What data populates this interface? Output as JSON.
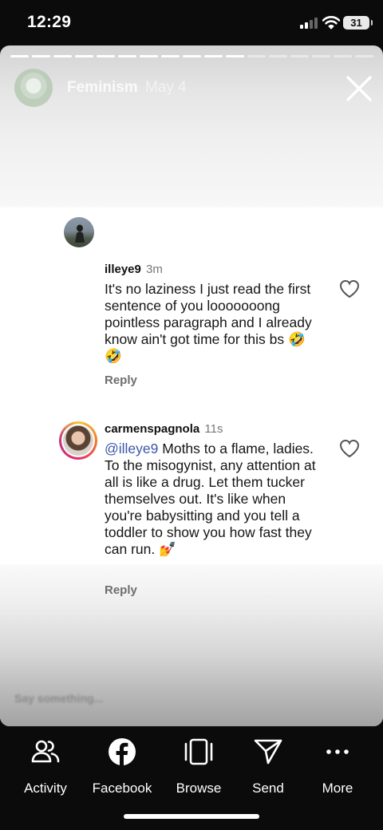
{
  "status_bar": {
    "time": "12:29",
    "battery": "31"
  },
  "story": {
    "account": "Feminism",
    "date": "May 4",
    "progress_total": 17,
    "progress_done": 11,
    "reply_placeholder": "Say something..."
  },
  "comments": [
    {
      "username": "illeye9",
      "time": "3m",
      "text": "It's no laziness I just read the first sentence of you looooooong pointless paragraph and I already know ain't got time for this bs 🤣🤣",
      "reply_label": "Reply"
    },
    {
      "username": "carmenspagnola",
      "time": "11s",
      "mention": "@illeye9",
      "text": " Moths to a flame, ladies. To the misogynist, any attention at all is like a drug. Let them tucker themselves out. It's like when you're babysitting and you tell a toddler to show you how fast they can run. 💅",
      "reply_label": "Reply"
    }
  ],
  "bottom_actions": [
    {
      "label": "Activity",
      "icon": "people-icon"
    },
    {
      "label": "Facebook",
      "icon": "facebook-icon"
    },
    {
      "label": "Browse",
      "icon": "browse-icon"
    },
    {
      "label": "Send",
      "icon": "send-icon"
    },
    {
      "label": "More",
      "icon": "more-icon"
    }
  ]
}
